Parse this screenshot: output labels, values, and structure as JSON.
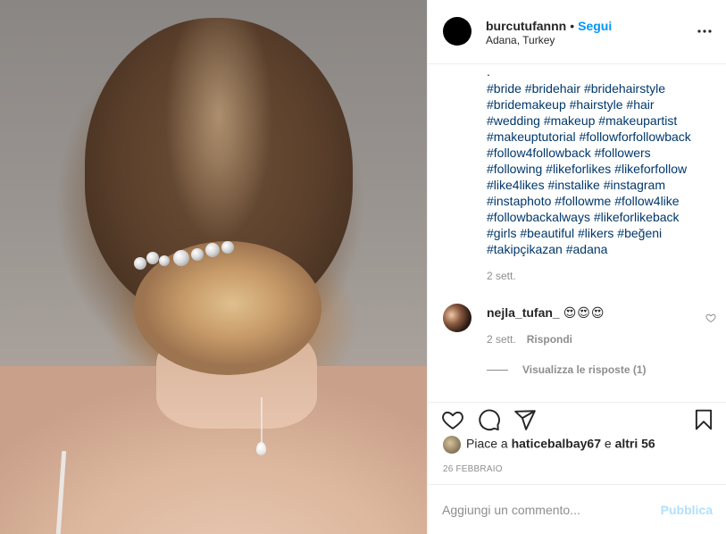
{
  "post": {
    "username": "burcutufannn",
    "separator": "•",
    "follow_label": "Segui",
    "location": "Adana, Turkey"
  },
  "caption": {
    "dot": ".",
    "lines": [
      "#bride #bridehair #bridehairstyle",
      "#bridemakeup #hairstyle #hair",
      "#wedding #makeup #makeupartist",
      "#makeuptutorial #followforfollowback",
      "#follow4followback #followers",
      "#following #likeforlikes #likeforfollow",
      "#like4likes #instalike #instagram",
      "#instaphoto #followme #follow4like",
      "#followbackalways #likeforlikeback",
      "#girls #beautiful #likers #beğeni",
      "#takipçikazan #adana"
    ],
    "time": "2 sett."
  },
  "comment": {
    "username": "nejla_tufan_",
    "emojis": "😍😍😍",
    "time": "2 sett.",
    "reply_label": "Rispondi",
    "view_replies_label": "Visualizza le risposte (1)"
  },
  "likes": {
    "prefix": "Piace a",
    "liker": "haticebalbay67",
    "joiner": "e",
    "others": "altri 56"
  },
  "date": "26 FEBBRAIO",
  "add_comment": {
    "placeholder": "Aggiungi un commento...",
    "publish_label": "Pubblica"
  },
  "colors": {
    "accent": "#0095f6",
    "hashtag": "#00376b",
    "muted": "#8e8e8e",
    "publish_disabled": "#b2dffc"
  },
  "icons": [
    "more-options-icon",
    "heart-icon",
    "comment-icon",
    "share-icon",
    "bookmark-icon",
    "small-heart-icon"
  ]
}
